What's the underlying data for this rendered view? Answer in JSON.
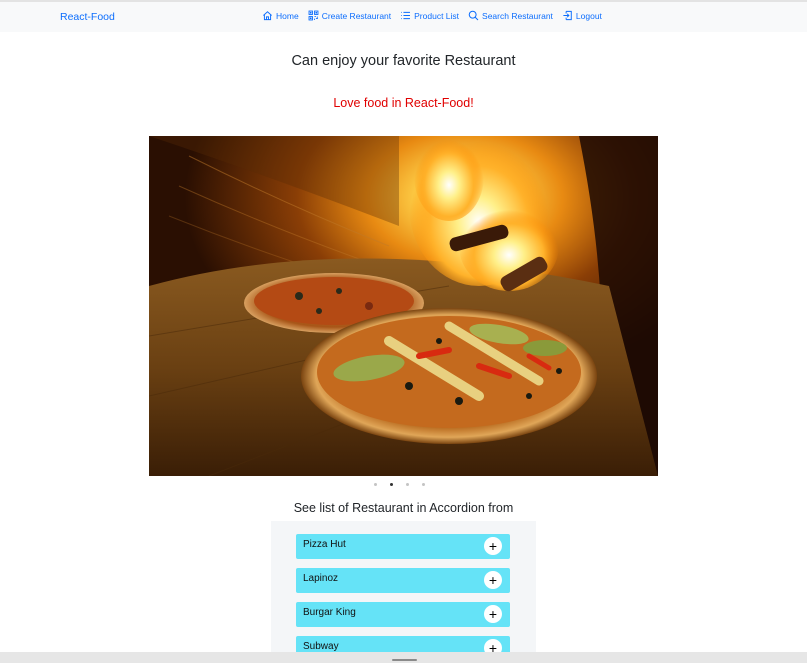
{
  "navbar": {
    "brand": "React-Food",
    "links": [
      {
        "label": "Home",
        "icon": "house-icon"
      },
      {
        "label": "Create Restaurant",
        "icon": "qr-grid-icon"
      },
      {
        "label": "Product List",
        "icon": "list-icon"
      },
      {
        "label": "Search Restaurant",
        "icon": "search-icon"
      },
      {
        "label": "Logout",
        "icon": "logout-icon"
      }
    ]
  },
  "main": {
    "title": "Can enjoy your favorite Restaurant",
    "subtitle": "Love food in React-Food!",
    "carousel": {
      "slide_count": 4,
      "active_index": 1,
      "image": "pizza-in-wood-fired-oven"
    },
    "accordion": {
      "heading": "See list of Restaurant in Accordion from",
      "items": [
        {
          "label": "Pizza Hut",
          "toggle": "+"
        },
        {
          "label": "Lapinoz",
          "toggle": "+"
        },
        {
          "label": "Burgar King",
          "toggle": "+"
        },
        {
          "label": "Subway",
          "toggle": "+"
        }
      ]
    }
  },
  "colors": {
    "link": "#0d6efd",
    "subtitle": "#e00000",
    "accordion_item": "#65e3f7"
  }
}
